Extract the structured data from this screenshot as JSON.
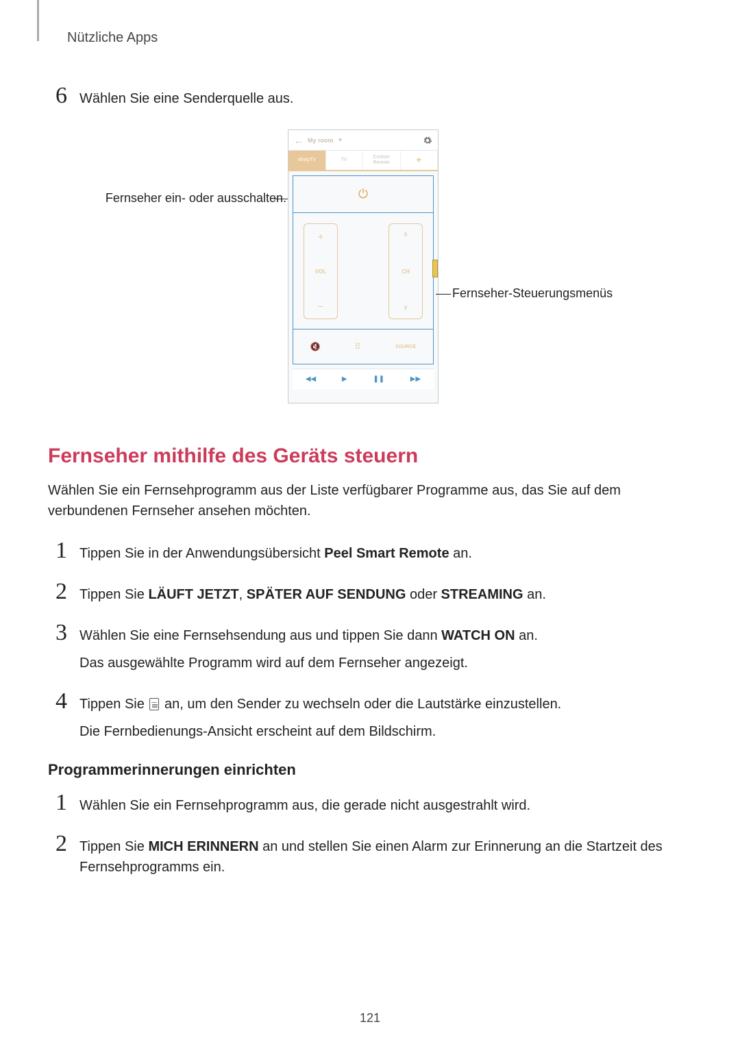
{
  "breadcrumb": "Nützliche Apps",
  "step6": {
    "num": "6",
    "text": "Wählen Sie eine Senderquelle aus."
  },
  "figure": {
    "top": {
      "room_label": "My room",
      "tabs": {
        "t1": "xfinityTV",
        "t2": "TV",
        "t3": "Custom\nRemote"
      },
      "vol_label": "VOL",
      "ch_label": "CH",
      "source_label": "SOURCE"
    },
    "callout_left": "Fernseher ein- oder ausschalten.",
    "callout_right": "Fernseher-Steuerungsmenüs"
  },
  "heading": "Fernseher mithilfe des Geräts steuern",
  "intro": "Wählen Sie ein Fernsehprogramm aus der Liste verfügbarer Programme aus, das Sie auf dem verbundenen Fernseher ansehen möchten.",
  "steps": {
    "s1": {
      "num": "1",
      "pre": "Tippen Sie in der Anwendungsübersicht ",
      "b1": "Peel Smart Remote",
      "post": " an."
    },
    "s2": {
      "num": "2",
      "pre": "Tippen Sie ",
      "b1": "LÄUFT JETZT",
      "mid1": ", ",
      "b2": "SPÄTER AUF SENDUNG",
      "mid2": " oder ",
      "b3": "STREAMING",
      "post": " an."
    },
    "s3": {
      "num": "3",
      "pre": "Wählen Sie eine Fernsehsendung aus und tippen Sie dann ",
      "b1": "WATCH ON",
      "post": " an.",
      "sub": "Das ausgewählte Programm wird auf dem Fernseher angezeigt."
    },
    "s4": {
      "num": "4",
      "pre": "Tippen Sie ",
      "post": " an, um den Sender zu wechseln oder die Lautstärke einzustellen.",
      "sub": "Die Fernbedienungs-Ansicht erscheint auf dem Bildschirm."
    }
  },
  "subheading": "Programmerinnerungen einrichten",
  "rem": {
    "r1": {
      "num": "1",
      "text": "Wählen Sie ein Fernsehprogramm aus, die gerade nicht ausgestrahlt wird."
    },
    "r2": {
      "num": "2",
      "pre": "Tippen Sie ",
      "b1": "MICH ERINNERN",
      "post": " an und stellen Sie einen Alarm zur Erinnerung an die Startzeit des Fernsehprogramms ein."
    }
  },
  "page_number": "121"
}
